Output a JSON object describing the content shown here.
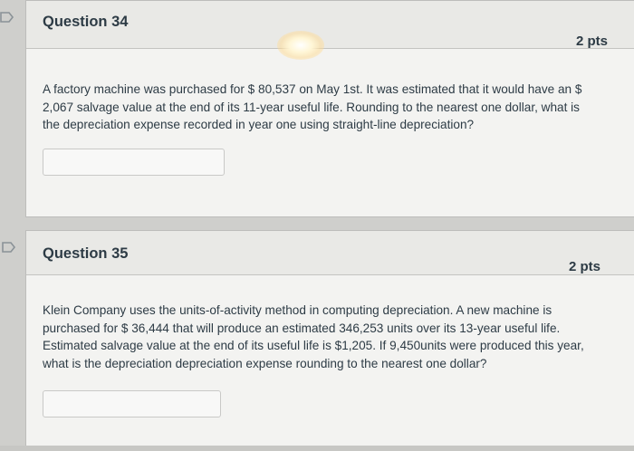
{
  "questions": [
    {
      "title": "Question 34",
      "points": "2 pts",
      "text_lines": [
        "A factory machine was purchased for $ 80,537 on May 1st. It was estimated that it would have an $",
        "2,067 salvage value at the end of its 11-year useful life. Rounding to the nearest one dollar, what is",
        "the depreciation expense recorded in year one using straight-line depreciation?"
      ],
      "answer_value": ""
    },
    {
      "title": "Question 35",
      "points": "2 pts",
      "text_lines": [
        "Klein Company uses the units-of-activity method in computing depreciation. A new machine is",
        "purchased for $ 36,444 that will produce an estimated 346,253 units over its 13-year useful life.",
        "Estimated salvage value at the end of its useful life is $1,205. If 9,450units were produced this year,",
        "what is the depreciation depreciation expense rounding to the nearest one dollar?"
      ],
      "answer_value": ""
    }
  ],
  "colors": {
    "text": "#2d3b45",
    "header_bg": "#e9e9e6",
    "card_bg": "#f3f3f1"
  },
  "icons": {
    "flag": "flag-outline-icon"
  }
}
